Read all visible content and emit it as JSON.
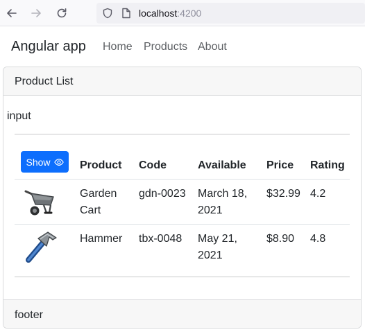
{
  "browser": {
    "url_host": "localhost",
    "url_port": ":4200"
  },
  "navbar": {
    "brand": "Angular app",
    "links": [
      "Home",
      "Products",
      "About"
    ]
  },
  "card": {
    "header": "Product List",
    "input_label": "input",
    "show_button": "Show",
    "columns": [
      "Product",
      "Code",
      "Available",
      "Price",
      "Rating"
    ],
    "rows": [
      {
        "image_icon": "wheelbarrow-icon",
        "product": "Garden Cart",
        "code": "gdn-0023",
        "available": "March 18, 2021",
        "price": "$32.99",
        "rating": "4.2"
      },
      {
        "image_icon": "hammer-icon",
        "product": "Hammer",
        "code": "tbx-0048",
        "available": "May 21, 2021",
        "price": "$8.90",
        "rating": "4.8"
      }
    ],
    "footer": "footer"
  },
  "colors": {
    "primary": "#0d6efd",
    "nav_link": "#5c5f63"
  }
}
